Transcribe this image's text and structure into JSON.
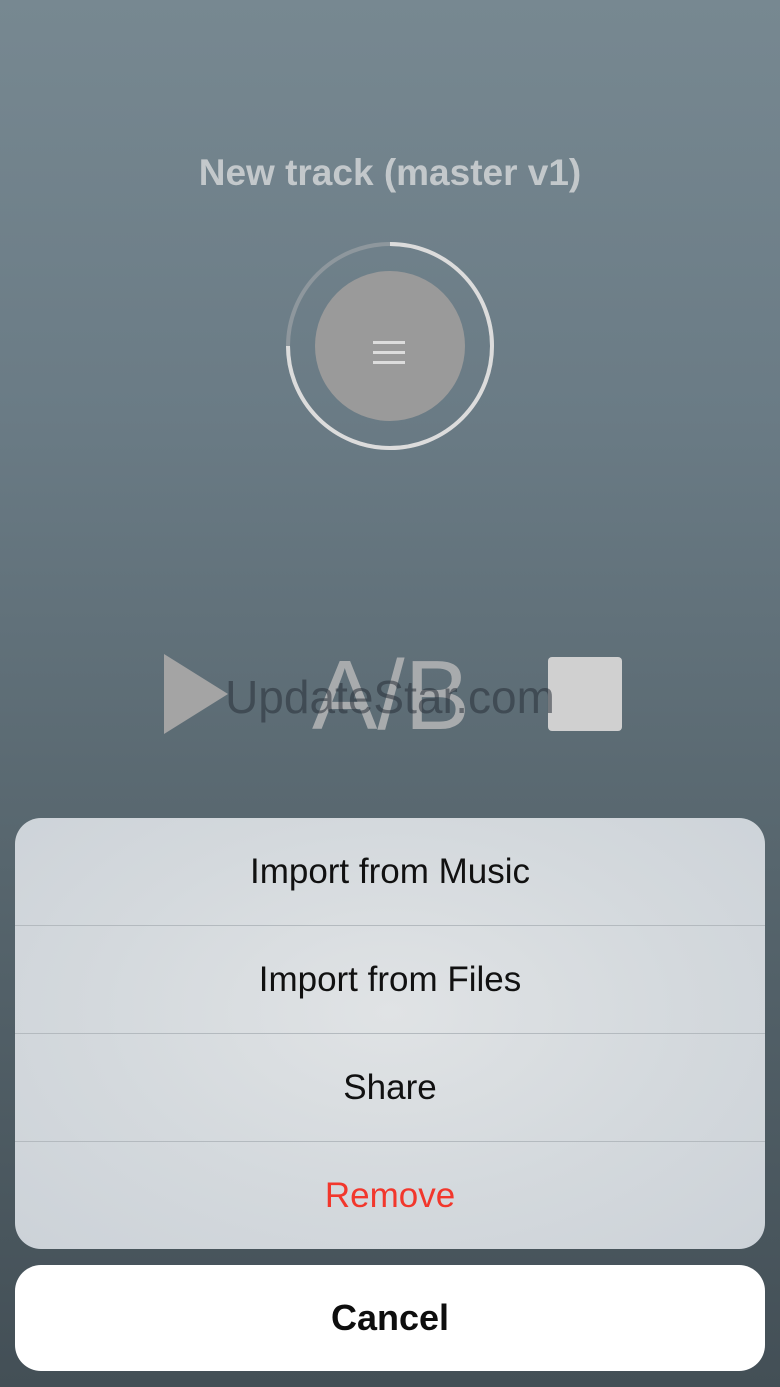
{
  "player": {
    "track_title": "New track (master v1)",
    "dial_icon": "menu-lines-icon",
    "controls": {
      "play_icon": "play-icon",
      "ab_label": "A/B",
      "stop_icon": "stop-icon"
    }
  },
  "watermark": "UpdateStar.com",
  "action_sheet": {
    "items": [
      {
        "label": "Import from Music"
      },
      {
        "label": "Import from Files"
      },
      {
        "label": "Share"
      },
      {
        "label": "Remove"
      }
    ],
    "cancel_label": "Cancel"
  },
  "colors": {
    "destructive": "#f2372c",
    "sheet_background": "#d4d9dd",
    "cancel_background": "#ffffff"
  }
}
